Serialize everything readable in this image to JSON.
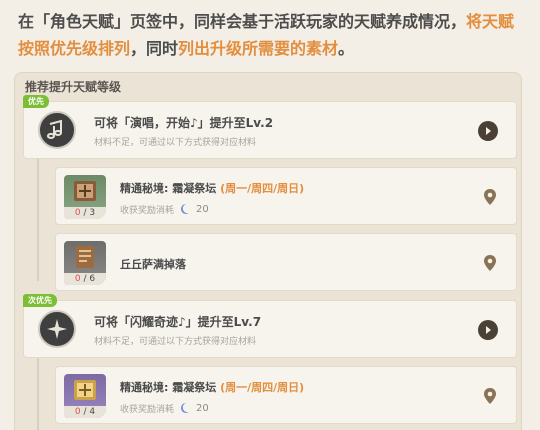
{
  "intro": {
    "seg1": "在「角色天赋」页签中，同样会基于活跃玩家的天赋养成情况，",
    "seg2": "将天赋按照优先级排列",
    "seg3": "，同时",
    "seg4": "列出升级所需要的素材",
    "seg5": "。"
  },
  "panel": {
    "title": "推荐提升天赋等级"
  },
  "talents": [
    {
      "tag": "优先",
      "name": "可将「演唱，开始♪」提升至Lv.2",
      "sub": "材料不足，可通过以下方式获得对应材料",
      "icon": "music-note-icon"
    },
    {
      "tag": "次优先",
      "name": "可将「闪耀奇迹♪」提升至Lv.7",
      "sub": "材料不足，可通过以下方式获得对应材料",
      "icon": "sparkle-icon"
    }
  ],
  "materials": [
    {
      "title": "精通秘境: 霜凝祭坛",
      "days": "(周一/周四/周日)",
      "cost_label": "收获奖励消耗",
      "cost": "20",
      "have": "0",
      "need": "3",
      "color": "green"
    },
    {
      "title": "丘丘萨满掉落",
      "have": "0",
      "need": "6",
      "color": "gray"
    },
    {
      "title": "精通秘境: 霜凝祭坛",
      "days": "(周一/周四/周日)",
      "cost_label": "收获奖励消耗",
      "cost": "20",
      "have": "0",
      "need": "4",
      "color": "purple"
    }
  ],
  "colors": {
    "accent": "#e38e3e",
    "priority_tag": "#7cbf36",
    "low_count": "#d9534f"
  }
}
